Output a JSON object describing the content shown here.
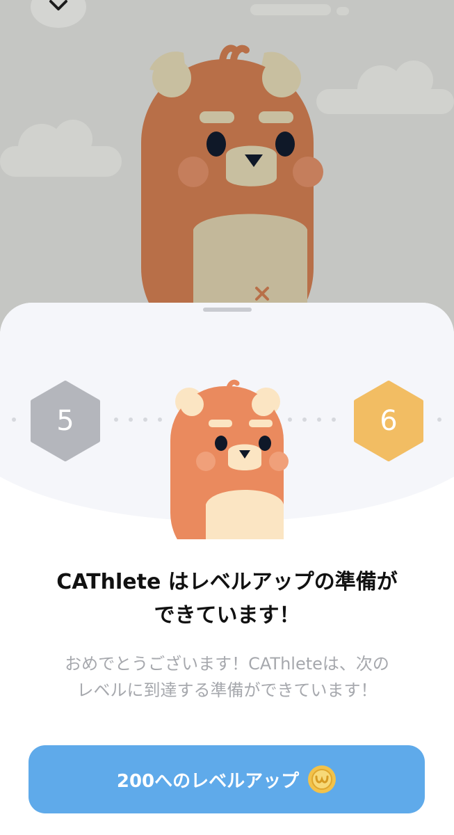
{
  "header": {
    "close_icon": "chevron-down-icon"
  },
  "level": {
    "current": "5",
    "next": "6"
  },
  "dialog": {
    "title_line1": "CAThlete はレベルアップの準備が",
    "title_line2": "できています！",
    "message_line1": "おめでとうございます！CAThleteは、次の",
    "message_line2": "レベルに到達する準備ができています！"
  },
  "cta": {
    "label": "200へのレベルアップ",
    "currency_icon": "coin-icon"
  },
  "colors": {
    "background": "#c5c6c3",
    "bear_large": "#b86f48",
    "bear_small": "#ea8a5e",
    "current_level_hex": "#b4b6bc",
    "next_level_hex": "#f2bd63",
    "button": "#5faaea"
  }
}
